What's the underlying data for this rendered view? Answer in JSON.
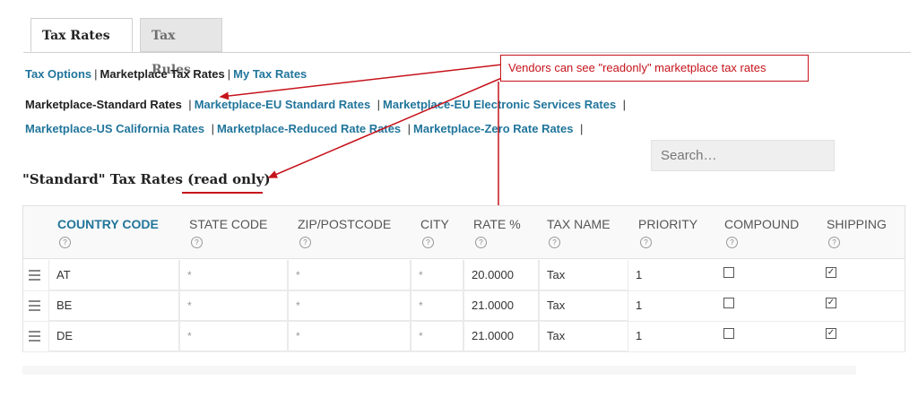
{
  "tabs": [
    {
      "label": "Tax Rates",
      "active": true
    },
    {
      "label": "Tax Rules",
      "active": false
    }
  ],
  "subnav": {
    "tax_options": "Tax Options",
    "marketplace_tax_rates": "Marketplace Tax Rates",
    "my_tax_rates": "My Tax Rates"
  },
  "rate_links": {
    "current": "Marketplace-Standard Rates",
    "items": [
      "Marketplace-EU Standard Rates",
      "Marketplace-EU Electronic Services Rates",
      "Marketplace-US California Rates",
      "Marketplace-Reduced Rate Rates",
      "Marketplace-Zero Rate Rates"
    ]
  },
  "search": {
    "placeholder": "Search…"
  },
  "heading": {
    "main": "\"Standard\" Tax Rates",
    "suffix": "(read only)"
  },
  "callout": {
    "text": "Vendors can see \"readonly\" marketplace tax rates"
  },
  "columns": [
    "COUNTRY CODE",
    "STATE CODE",
    "ZIP/POSTCODE",
    "CITY",
    "RATE %",
    "TAX NAME",
    "PRIORITY",
    "COMPOUND",
    "SHIPPING"
  ],
  "help_glyph": "?",
  "rows": [
    {
      "country": "AT",
      "state": "*",
      "zip": "*",
      "city": "*",
      "rate": "20.0000",
      "name": "Tax",
      "priority": "1",
      "compound": false,
      "shipping": true
    },
    {
      "country": "BE",
      "state": "*",
      "zip": "*",
      "city": "*",
      "rate": "21.0000",
      "name": "Tax",
      "priority": "1",
      "compound": false,
      "shipping": true
    },
    {
      "country": "DE",
      "state": "*",
      "zip": "*",
      "city": "*",
      "rate": "21.0000",
      "name": "Tax",
      "priority": "1",
      "compound": false,
      "shipping": true
    }
  ],
  "check_glyph": "✓",
  "colors": {
    "link": "#21759b",
    "annotation": "#c6131b"
  }
}
